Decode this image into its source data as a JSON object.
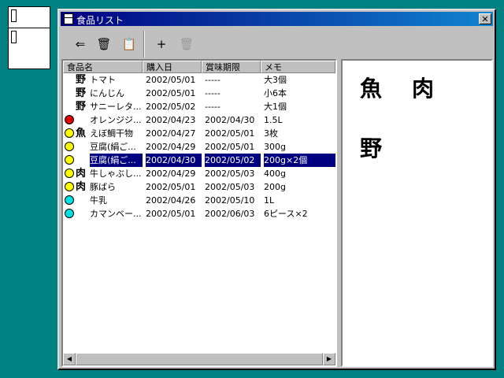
{
  "window": {
    "title": "食品リスト",
    "close_glyph": "✕"
  },
  "toolbar": {
    "buttons": [
      {
        "name": "checkout-icon",
        "glyph": "⇐",
        "enabled": true
      },
      {
        "name": "trash-icon",
        "glyph": "🗑",
        "enabled": true
      },
      {
        "name": "paste-icon",
        "glyph": "📋",
        "enabled": true
      },
      {
        "name": "add-icon",
        "glyph": "+",
        "enabled": true
      },
      {
        "name": "delete-icon",
        "glyph": "🗑",
        "enabled": false
      }
    ]
  },
  "list": {
    "columns": [
      "食品名",
      "購入日",
      "賞味期限",
      "メモ"
    ],
    "rows": [
      {
        "status": "",
        "category": "野",
        "name": "トマト",
        "purchase": "2002/05/01",
        "expiry": "-----",
        "memo": "大3個",
        "selected": false
      },
      {
        "status": "",
        "category": "野",
        "name": "にんじん",
        "purchase": "2002/05/01",
        "expiry": "-----",
        "memo": "小6本",
        "selected": false
      },
      {
        "status": "",
        "category": "野",
        "name": "サニーレタ...",
        "purchase": "2002/05/02",
        "expiry": "-----",
        "memo": "大1個",
        "selected": false
      },
      {
        "status": "red",
        "category": "",
        "name": "オレンジジ...",
        "purchase": "2002/04/23",
        "expiry": "2002/04/30",
        "memo": "1.5L",
        "selected": false
      },
      {
        "status": "yellow",
        "category": "魚",
        "name": "えぼ鯛干物",
        "purchase": "2002/04/27",
        "expiry": "2002/05/01",
        "memo": "3枚",
        "selected": false
      },
      {
        "status": "yellow",
        "category": "",
        "name": "豆腐(絹ご...",
        "purchase": "2002/04/29",
        "expiry": "2002/05/01",
        "memo": "300g",
        "selected": false
      },
      {
        "status": "yellow",
        "category": "",
        "name": "豆腐(絹ご...",
        "purchase": "2002/04/30",
        "expiry": "2002/05/02",
        "memo": "200g×2個",
        "selected": true
      },
      {
        "status": "yellow",
        "category": "肉",
        "name": "牛しゃぶし...",
        "purchase": "2002/04/29",
        "expiry": "2002/05/03",
        "memo": "400g",
        "selected": false
      },
      {
        "status": "yellow",
        "category": "肉",
        "name": "豚ばら",
        "purchase": "2002/05/01",
        "expiry": "2002/05/03",
        "memo": "200g",
        "selected": false
      },
      {
        "status": "cyan",
        "category": "",
        "name": "牛乳",
        "purchase": "2002/04/26",
        "expiry": "2002/05/10",
        "memo": "1L",
        "selected": false
      },
      {
        "status": "cyan",
        "category": "",
        "name": "カマンベー...",
        "purchase": "2002/05/01",
        "expiry": "2002/06/03",
        "memo": "6ピース×2",
        "selected": false
      }
    ]
  },
  "status_colors": {
    "red": "#e00000",
    "yellow": "#ffff00",
    "cyan": "#00e0e0"
  },
  "categories": [
    "魚",
    "肉",
    "野"
  ]
}
